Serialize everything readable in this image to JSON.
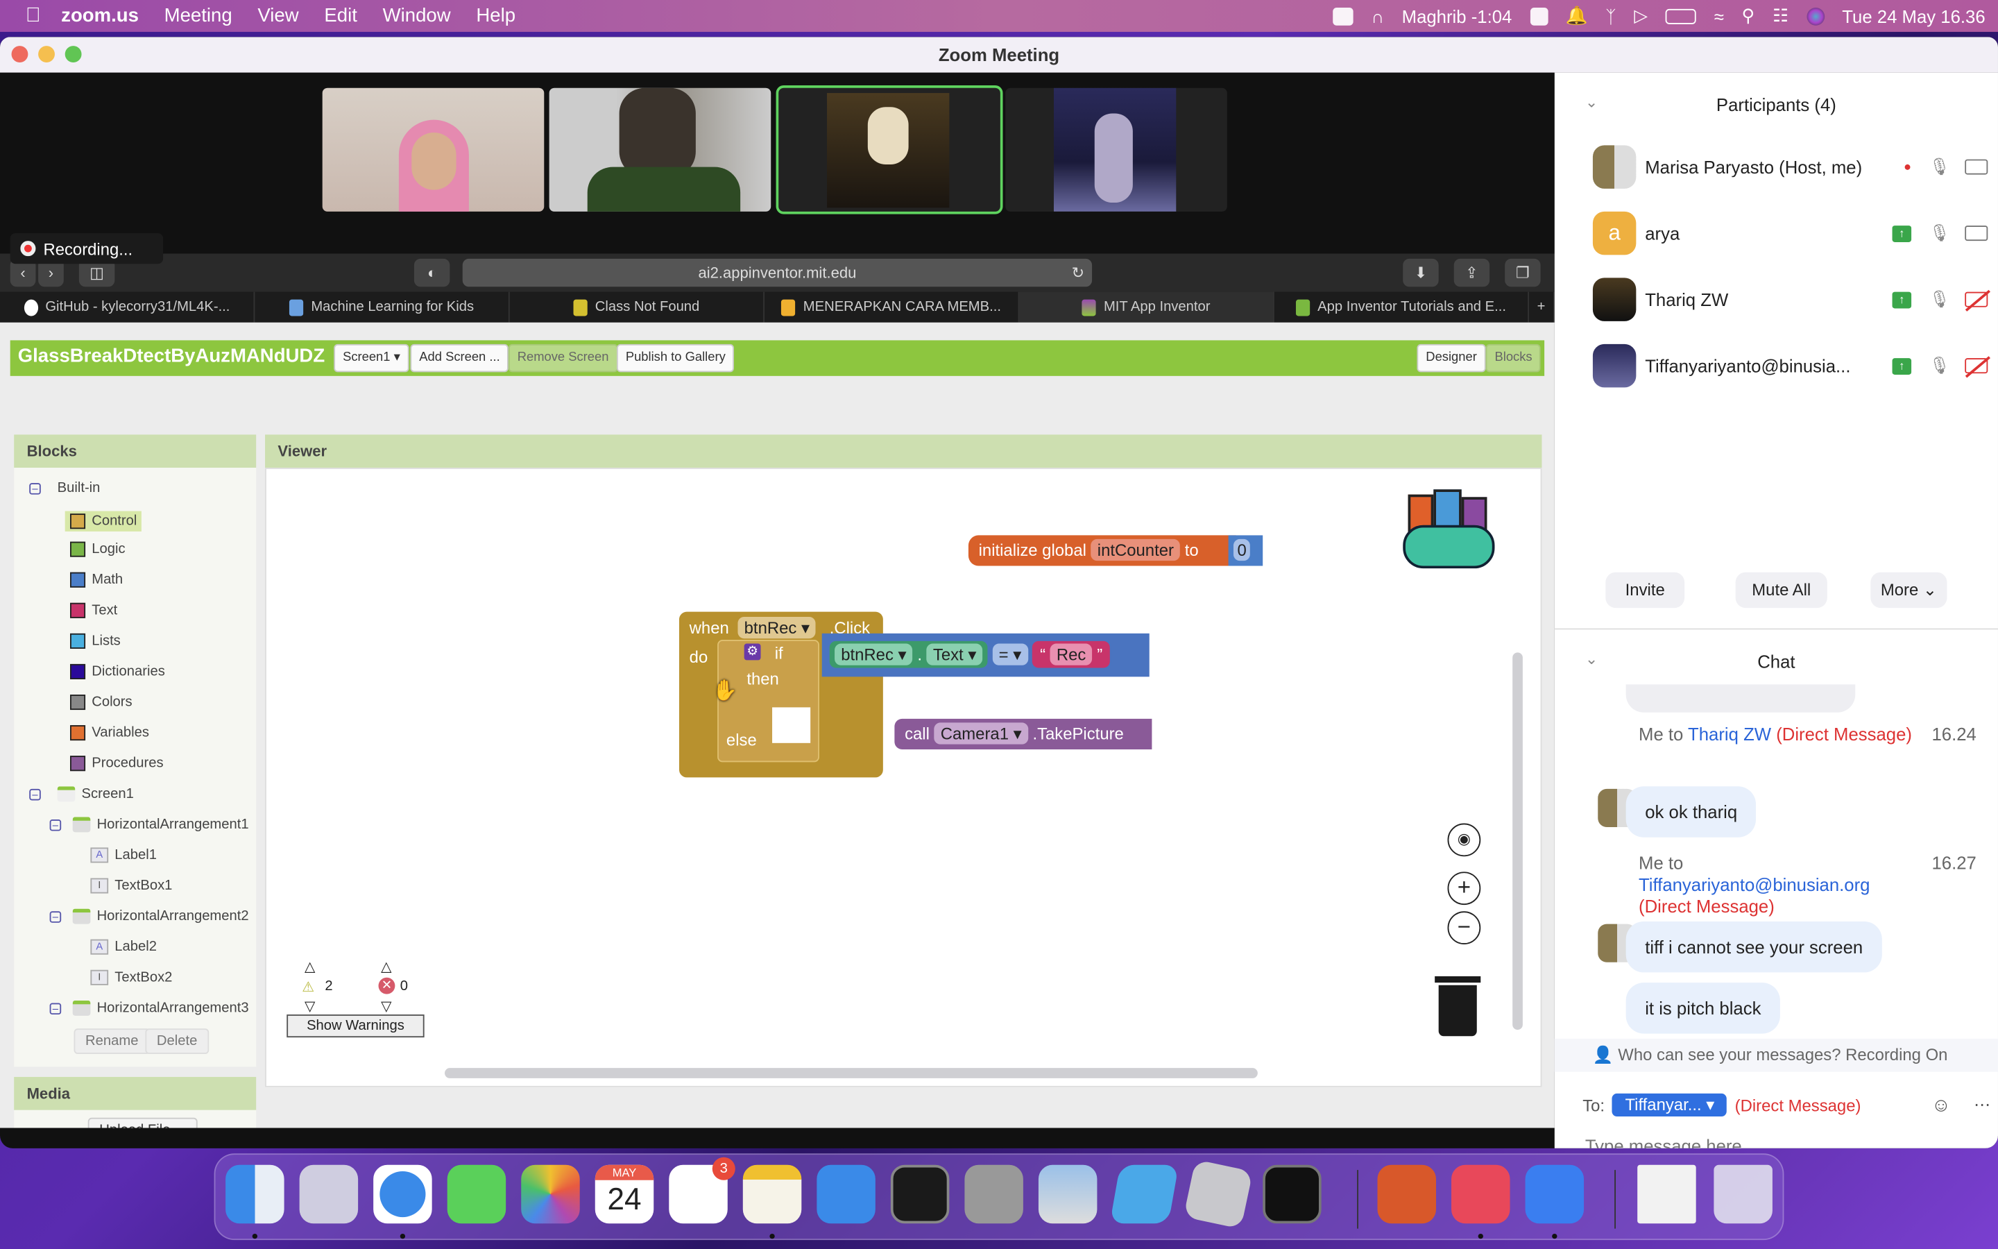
{
  "menubar": {
    "apple_icon": "apple-logo",
    "app_name": "zoom.us",
    "menus": [
      "Meeting",
      "View",
      "Edit",
      "Window",
      "Help"
    ],
    "prayer": "Maghrib -1:04",
    "datetime": "Tue 24 May  16.36"
  },
  "window": {
    "title": "Zoom Meeting",
    "recording_label": "Recording..."
  },
  "video_tiles": [
    {
      "name": "tile-1",
      "active": false
    },
    {
      "name": "tile-2",
      "active": false
    },
    {
      "name": "tile-3",
      "active": true
    },
    {
      "name": "tile-4",
      "active": false
    }
  ],
  "browser": {
    "url": "ai2.appinventor.mit.edu",
    "tabs": [
      {
        "label": "GitHub - kylecorry31/ML4K-...",
        "active": false,
        "color": "#ffffff"
      },
      {
        "label": "Machine Learning for Kids",
        "active": false,
        "color": "#6aa0e0"
      },
      {
        "label": "Class Not Found",
        "active": false,
        "color": "#d4c030"
      },
      {
        "label": "MENERAPKAN CARA MEMB...",
        "active": false,
        "color": "#f0b030"
      },
      {
        "label": "MIT App Inventor",
        "active": true,
        "color": "#9a4ab0"
      },
      {
        "label": "App Inventor Tutorials and E...",
        "active": false,
        "color": "#7ab840"
      }
    ],
    "new_tab": "+"
  },
  "appinventor": {
    "project_title": "GlassBreakDtectByAuzMANdUDZ",
    "screen_select": "Screen1 ▾",
    "add_screen": "Add Screen ...",
    "remove_screen": "Remove Screen",
    "publish": "Publish to Gallery",
    "designer": "Designer",
    "blocks": "Blocks",
    "blocks_panel_title": "Blocks",
    "viewer_title": "Viewer",
    "media_title": "Media",
    "upload_file": "Upload File ...",
    "rename": "Rename",
    "delete": "Delete",
    "builtin_label": "Built-in",
    "builtin": [
      {
        "label": "Control",
        "color": "#d4aa4a",
        "selected": true
      },
      {
        "label": "Logic",
        "color": "#7ab648"
      },
      {
        "label": "Math",
        "color": "#4a7ec8"
      },
      {
        "label": "Text",
        "color": "#c8346a"
      },
      {
        "label": "Lists",
        "color": "#4ab0e0"
      },
      {
        "label": "Dictionaries",
        "color": "#2a0a9a"
      },
      {
        "label": "Colors",
        "color": "#888888"
      },
      {
        "label": "Variables",
        "color": "#e07030"
      },
      {
        "label": "Procedures",
        "color": "#8a5a98"
      }
    ],
    "components": [
      {
        "label": "Screen1",
        "level": 0,
        "type": "screen",
        "collapsible": true
      },
      {
        "label": "HorizontalArrangement1",
        "level": 1,
        "type": "arrangement",
        "collapsible": true
      },
      {
        "label": "Label1",
        "level": 2,
        "type": "label"
      },
      {
        "label": "TextBox1",
        "level": 2,
        "type": "textbox"
      },
      {
        "label": "HorizontalArrangement2",
        "level": 1,
        "type": "arrangement",
        "collapsible": true
      },
      {
        "label": "Label2",
        "level": 2,
        "type": "label"
      },
      {
        "label": "TextBox2",
        "level": 2,
        "type": "textbox"
      },
      {
        "label": "HorizontalArrangement3",
        "level": 1,
        "type": "arrangement",
        "collapsible": true
      }
    ],
    "workspace": {
      "init_global": {
        "prefix": "initialize global",
        "name": "intCounter",
        "to": "to",
        "value": "0"
      },
      "event": {
        "when": "when",
        "component": "btnRec",
        "event": ".Click",
        "do": "do"
      },
      "if_block": {
        "if": "if",
        "then": "then",
        "else": "else"
      },
      "compare": {
        "component": "btnRec",
        "dot": ".",
        "property": "Text",
        "op": "=",
        "string": "Rec"
      },
      "call": {
        "call": "call",
        "component": "Camera1",
        "method": ".TakePicture"
      },
      "warnings_count": "2",
      "errors_count": "0",
      "show_warnings": "Show Warnings"
    }
  },
  "participants": {
    "title": "Participants (4)",
    "list": [
      {
        "name": "Marisa Paryasto  (Host, me)",
        "recording": true,
        "sharing": false,
        "camera_off": false
      },
      {
        "name": "arya",
        "initial": "a",
        "sharing": true,
        "camera_off": false
      },
      {
        "name": "Thariq ZW",
        "sharing": true,
        "camera_off": true
      },
      {
        "name": "Tiffanyariyanto@binusia...",
        "sharing": true,
        "camera_off": true
      }
    ],
    "invite": "Invite",
    "mute_all": "Mute All",
    "more": "More"
  },
  "chat": {
    "title": "Chat",
    "messages": [
      {
        "from": "Me to",
        "to": "Thariq ZW",
        "dm": "(Direct Message)",
        "time": "16.24",
        "texts": [
          "ok ok thariq"
        ]
      },
      {
        "from": "Me to",
        "to": "Tiffanyariyanto@binusian.org",
        "dm": "(Direct Message)",
        "time": "16.27",
        "texts": [
          "tiff i cannot see your screen",
          "it is pitch black"
        ]
      }
    ],
    "privacy_notice": "Who can see your messages? Recording On",
    "to_label": "To:",
    "recipient": "Tiffanyar...",
    "recipient_dm": "(Direct Message)",
    "placeholder": "Type message here..."
  },
  "dock": {
    "apps": [
      "Finder",
      "Launchpad",
      "Safari",
      "Messages",
      "Photos",
      "Calendar",
      "Reminders",
      "Notes",
      "Keynote",
      "Terminal",
      "System Preferences",
      "Preview",
      "Roblox Studio",
      "Roblox",
      "Activity Monitor",
      "PowerPoint",
      "Music",
      "Zoom",
      "PDF Document",
      "Trash"
    ],
    "calendar_month": "MAY",
    "calendar_day": "24",
    "reminders_badge": "3"
  }
}
